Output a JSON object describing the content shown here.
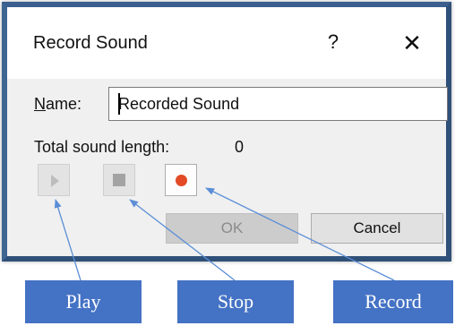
{
  "dialog": {
    "title": "Record Sound",
    "help_glyph": "?",
    "close_glyph": "✕",
    "name_label_accel": "N",
    "name_label_rest": "ame:",
    "name_value": "Recorded Sound",
    "total_label": "Total sound length:",
    "total_value": "0",
    "ok_label": "OK",
    "cancel_label": "Cancel",
    "buttons": {
      "play_icon": "play-icon",
      "stop_icon": "stop-icon",
      "record_icon": "record-icon"
    }
  },
  "callouts": {
    "play": "Play",
    "stop": "Stop",
    "record": "Record"
  },
  "colors": {
    "window_border": "#2f5079",
    "callout_fill": "#4472c4",
    "arrow": "#5b8ed6",
    "record_dot": "#e34a25"
  }
}
